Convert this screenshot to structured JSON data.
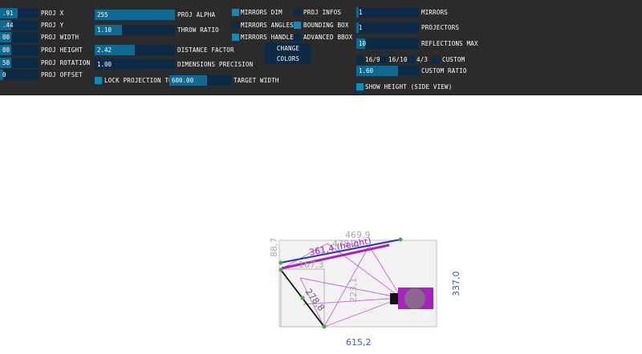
{
  "left_sliders": [
    {
      "value": ".91",
      "label": "PROJ X",
      "fill": 0.45
    },
    {
      "value": ".44",
      "label": "PROJ Y",
      "fill": 0.3
    },
    {
      "value": "00",
      "label": "PROJ WIDTH",
      "fill": 0.3
    },
    {
      "value": "00",
      "label": "PROJ HEIGHT",
      "fill": 0.3
    },
    {
      "value": "50",
      "label": "PROJ ROTATION",
      "fill": 0.3
    },
    {
      "value": "0",
      "label": "PROJ OFFSET",
      "fill": 0.08
    }
  ],
  "mid_sliders": [
    {
      "value": "255",
      "label": "PROJ ALPHA",
      "fill": 1.0
    },
    {
      "value": "1.10",
      "label": "THROW RATIO",
      "fill": 0.34
    },
    {
      "value": "2.42",
      "label": "DISTANCE FACTOR",
      "fill": 0.5
    },
    {
      "value": "1.00",
      "label": "DIMENSIONS PRECISION",
      "fill": 0.0
    }
  ],
  "lock": {
    "label": "LOCK PROJECTION TO",
    "checked": true
  },
  "target_width": {
    "value": "600.00",
    "label": "TARGET WIDTH",
    "fill": 0.6
  },
  "toggles_col1": [
    {
      "label": "MIRRORS DIM",
      "checked": true
    },
    {
      "label": "MIRRORS ANGLES",
      "checked": false
    },
    {
      "label": "MIRRORS HANDLES",
      "checked": true
    }
  ],
  "toggles_col2": [
    {
      "label": "PROJ INFOS",
      "checked": false
    },
    {
      "label": "BOUNDING BOX",
      "checked": true
    },
    {
      "label": "ADVANCED BBOX",
      "checked": false
    }
  ],
  "change_colors_label": "CHANGE COLORS",
  "right_sliders": [
    {
      "value": "1",
      "label": "MIRRORS",
      "fill": 0.04
    },
    {
      "value": "1",
      "label": "PROJECTORS",
      "fill": 0.04
    },
    {
      "value": "10",
      "label": "REFLECTIONS MAX",
      "fill": 0.14
    }
  ],
  "ratio_toggles": [
    {
      "label": "16/9",
      "checked": false
    },
    {
      "label": "16/10",
      "checked": false
    },
    {
      "label": "4/3",
      "checked": false
    },
    {
      "label": "CUSTOM",
      "checked": false
    }
  ],
  "custom_ratio": {
    "value": "1.60",
    "label": "CUSTOM RATIO",
    "fill": 0.67
  },
  "show_height": {
    "label": "SHOW HEIGHT (SIDE VIEW)",
    "checked": true
  },
  "diagram": {
    "top_width": "469,9",
    "mirror_len": "478,2",
    "height_label": "361,4 (height)",
    "left_dim": "88,7",
    "inner_width": "167,3",
    "inner_height": "223,1",
    "diag_len": "278,8",
    "right_dim": "337,0",
    "bottom_dim": "615,2",
    "colors": {
      "mirror": "#2233cc",
      "purple": "#aa22bb",
      "grey": "#aaaaaa",
      "blue_text": "#4455bb"
    }
  }
}
